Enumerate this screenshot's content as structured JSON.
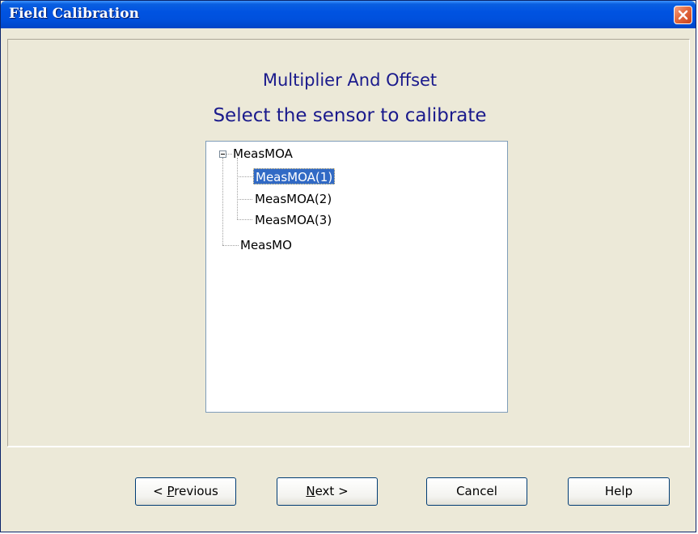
{
  "window": {
    "title": "Field Calibration"
  },
  "header": {
    "title": "Multiplier And Offset",
    "subtitle": "Select the sensor to calibrate"
  },
  "tree": {
    "nodes": [
      {
        "label": "MeasMOA",
        "expanded": true,
        "children": [
          {
            "label": "MeasMOA(1)",
            "selected": true
          },
          {
            "label": "MeasMOA(2)",
            "selected": false
          },
          {
            "label": "MeasMOA(3)",
            "selected": false
          }
        ]
      },
      {
        "label": "MeasMO",
        "expanded": false
      }
    ]
  },
  "buttons": {
    "previous_prefix": "< ",
    "previous_mnemonic": "P",
    "previous_rest": "revious",
    "next_mnemonic": "N",
    "next_rest": "ext >",
    "cancel": "Cancel",
    "help": "Help"
  },
  "colors": {
    "titlebar": "#0053e1",
    "heading": "#1a1a8c",
    "selection": "#316ac5",
    "dialog_bg": "#ece9d8"
  },
  "icons": {
    "close": "close-icon",
    "collapse": "minus-expander-icon"
  }
}
